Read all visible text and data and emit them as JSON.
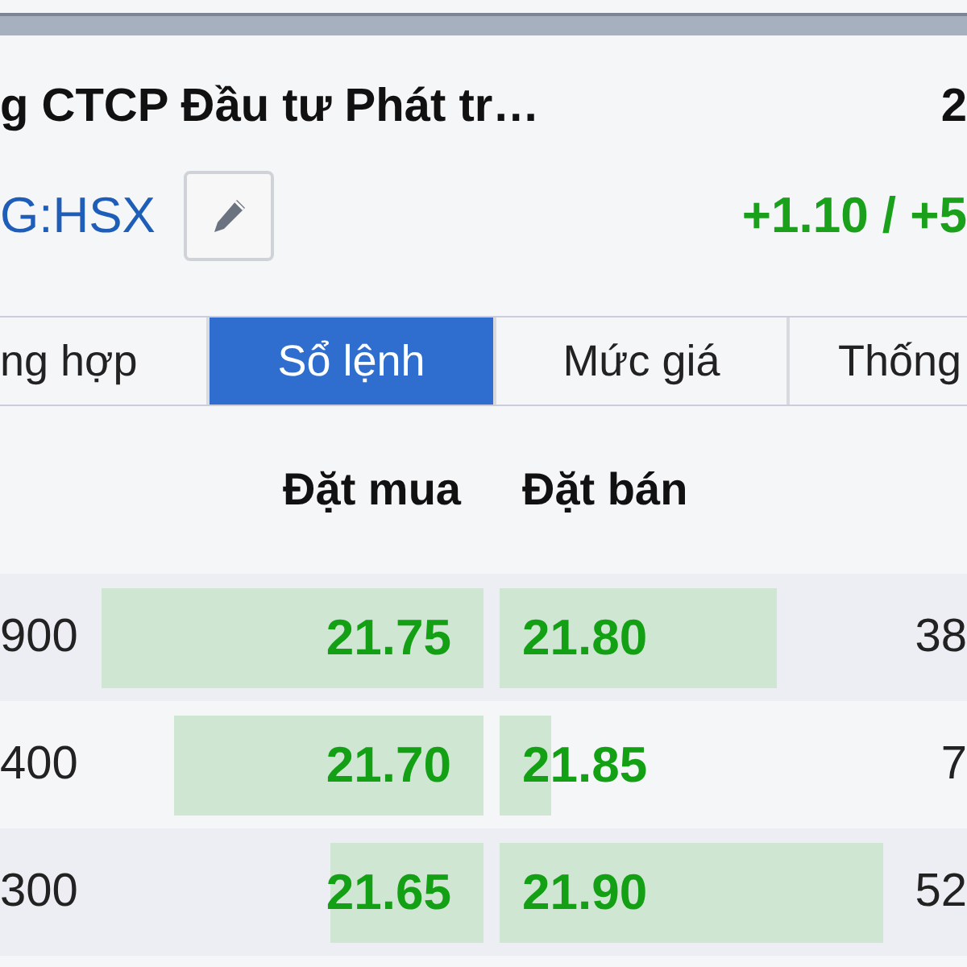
{
  "header": {
    "name": "g CTCP Đầu tư Phát tr…",
    "price": "2",
    "ticker": "G:HSX",
    "change": "+1.10 / +5"
  },
  "tabs": [
    {
      "label": "ng hợp",
      "selected": false
    },
    {
      "label": "Sổ lệnh",
      "selected": true
    },
    {
      "label": "Mức giá",
      "selected": false
    },
    {
      "label": "Thống",
      "selected": false
    }
  ],
  "order_book": {
    "columns": [
      "Đặt mua",
      "Đặt bán"
    ],
    "rows": [
      {
        "bid_volume": "900",
        "bid": {
          "price": "21.75"
        },
        "ask": {
          "price": "21.80"
        },
        "ask_volume": "38"
      },
      {
        "bid_volume": "400",
        "bid": {
          "price": "21.70"
        },
        "ask": {
          "price": "21.85"
        },
        "ask_volume": "7"
      },
      {
        "bid_volume": "300",
        "bid": {
          "price": "21.65"
        },
        "ask": {
          "price": "21.90"
        },
        "ask_volume": "52"
      }
    ]
  }
}
